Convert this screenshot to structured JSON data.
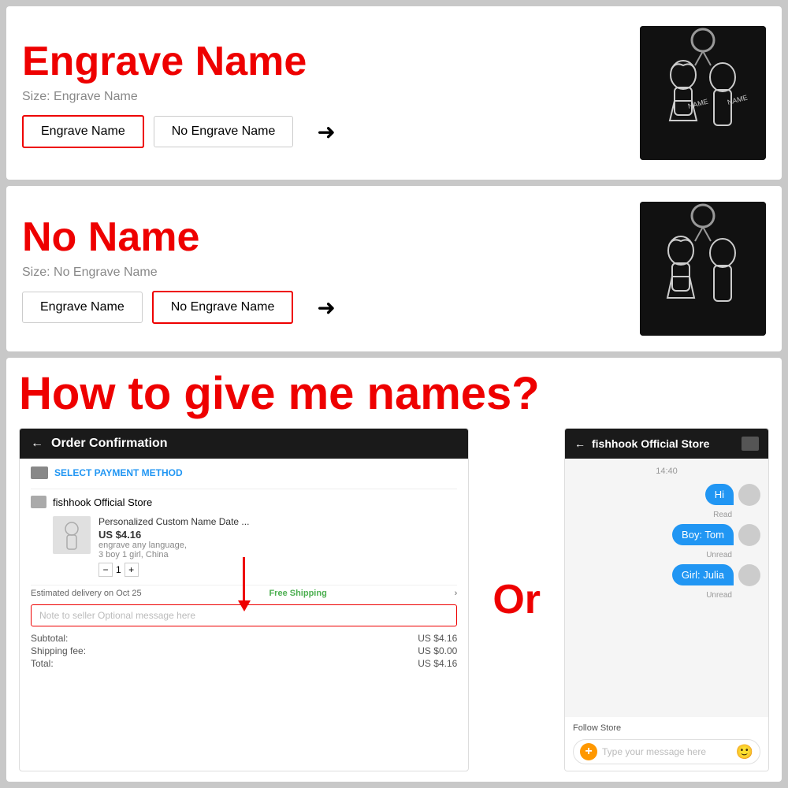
{
  "section1": {
    "title": "Engrave Name",
    "size_label": "Size: Engrave Name",
    "btn1": "Engrave Name",
    "btn2": "No Engrave Name",
    "selected": "btn1"
  },
  "section2": {
    "title": "No Name",
    "size_label": "Size: No Engrave Name",
    "btn1": "Engrave Name",
    "btn2": "No Engrave Name",
    "selected": "btn2"
  },
  "section3": {
    "title": "How to give me  names?",
    "or_text": "Or"
  },
  "order_confirmation": {
    "back": "←",
    "title": "Order Confirmation",
    "payment_label": "SELECT PAYMENT METHOD",
    "store_name": "fishhook Official Store",
    "product_name": "Personalized Custom Name Date ...",
    "product_price": "US $4.16",
    "product_desc1": "engrave any language,",
    "product_desc2": "3 boy 1 girl, China",
    "qty": "1",
    "delivery_text": "Estimated delivery on Oct 25",
    "free_shipping": "Free Shipping",
    "note_placeholder": "Note to seller  Optional message here",
    "subtotal_label": "Subtotal:",
    "subtotal_val": "US $4.16",
    "shipping_label": "Shipping fee:",
    "shipping_val": "US $0.00",
    "total_label": "Total:",
    "total_val": "US $4.16"
  },
  "chat": {
    "store_name": "fishhook Official Store",
    "time": "14:40",
    "msg1": "Hi",
    "msg1_status": "Read",
    "msg2": "Boy: Tom",
    "msg2_status": "Unread",
    "msg3": "Girl: Julia",
    "msg3_status": "Unread",
    "follow_store": "Follow Store",
    "input_placeholder": "Type your message here"
  }
}
